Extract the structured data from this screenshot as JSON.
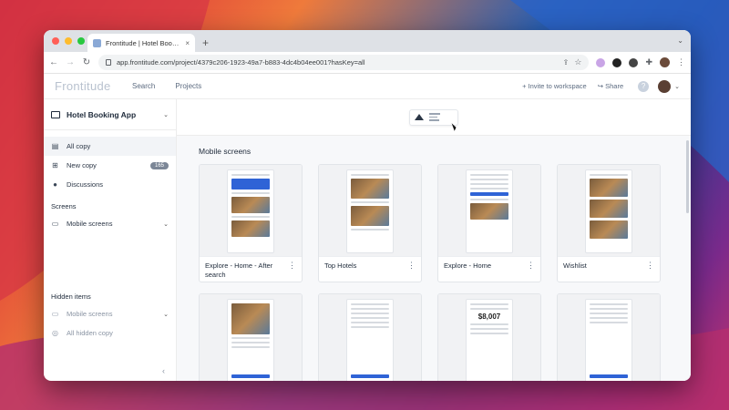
{
  "browser": {
    "tab_title": "Frontitude | Hotel Booking App",
    "tab_close": "×",
    "new_tab": "+",
    "url": "app.frontitude.com/project/4379c206-1923-49a7-b883-4dc4b04ee001?hasKey=all",
    "colors": {
      "close": "#ff5f57",
      "minimize": "#febc2e",
      "zoom": "#28c840"
    }
  },
  "app": {
    "logo": "Frontitude",
    "nav": [
      "Search",
      "Projects"
    ],
    "invite": "+ Invite to workspace",
    "share": "Share",
    "help": "?"
  },
  "sidebar": {
    "project_name": "Hotel Booking App",
    "items": [
      {
        "label": "All copy",
        "icon": "document-icon"
      },
      {
        "label": "New copy",
        "icon": "new-document-icon",
        "badge": "165"
      },
      {
        "label": "Discussions",
        "icon": "chat-icon"
      }
    ],
    "screens_heading": "Screens",
    "screens_item": "Mobile screens",
    "hidden_heading": "Hidden items",
    "hidden_items": [
      {
        "label": "Mobile screens",
        "icon": "folder-icon"
      },
      {
        "label": "All hidden copy",
        "icon": "eye-off-icon"
      }
    ],
    "collapse": "‹"
  },
  "main": {
    "group_title": "Mobile screens",
    "cards": [
      {
        "title": "Explore - Home - After search"
      },
      {
        "title": "Top Hotels"
      },
      {
        "title": "Explore - Home"
      },
      {
        "title": "Wishlist"
      },
      {
        "title": ""
      },
      {
        "title": ""
      },
      {
        "title": "",
        "price": "$8,007"
      },
      {
        "title": ""
      }
    ]
  }
}
